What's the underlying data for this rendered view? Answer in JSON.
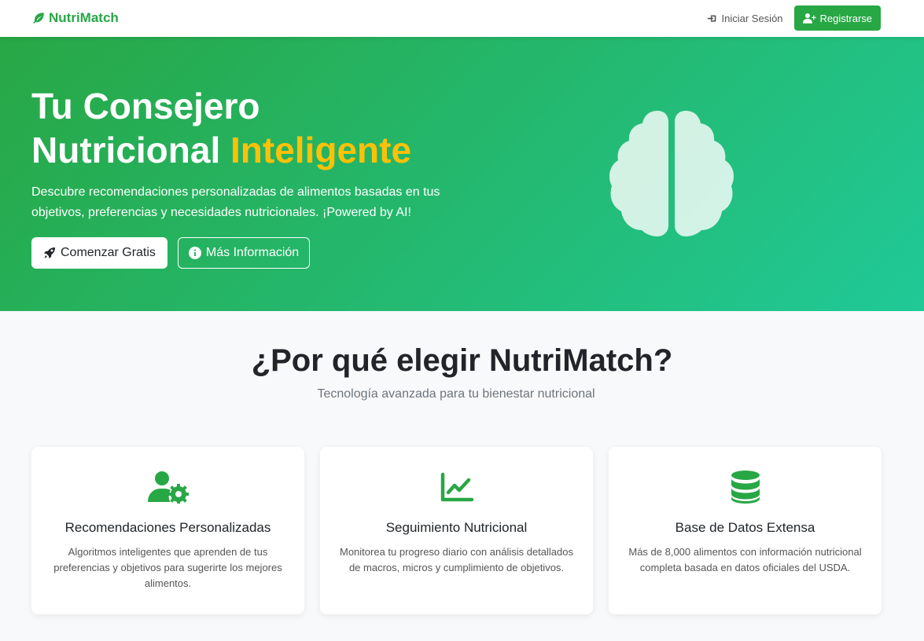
{
  "brand": {
    "name": "NutriMatch",
    "icon": "leaf-icon",
    "color": "#28a745"
  },
  "nav": {
    "login_label": "Iniciar Sesión",
    "register_label": "Registrarse"
  },
  "hero": {
    "title_line1": "Tu Consejero",
    "title_line2": "Nutricional",
    "title_accent": "Inteligente",
    "lead": "Descubre recomendaciones personalizadas de alimentos basadas en tus objetivos, preferencias y necesidades nutricionales. ¡Powered by AI!",
    "primary_button": "Comenzar Gratis",
    "secondary_button": "Más Información",
    "illustration_icon": "brain-icon",
    "gradient_start": "#28a745",
    "gradient_end": "#20c997",
    "accent_color": "#ffc107"
  },
  "features": {
    "title": "¿Por qué elegir NutriMatch?",
    "subtitle": "Tecnología avanzada para tu bienestar nutricional",
    "items": [
      {
        "icon": "user-gear-icon",
        "title": "Recomendaciones Personalizadas",
        "text": "Algoritmos inteligentes que aprenden de tus preferencias y objetivos para sugerirte los mejores alimentos."
      },
      {
        "icon": "chart-line-icon",
        "title": "Seguimiento Nutricional",
        "text": "Monitorea tu progreso diario con análisis detallados de macros, micros y cumplimiento de objetivos."
      },
      {
        "icon": "database-icon",
        "title": "Base de Datos Extensa",
        "text": "Más de 8,000 alimentos con información nutricional completa basada en datos oficiales del USDA."
      }
    ]
  }
}
